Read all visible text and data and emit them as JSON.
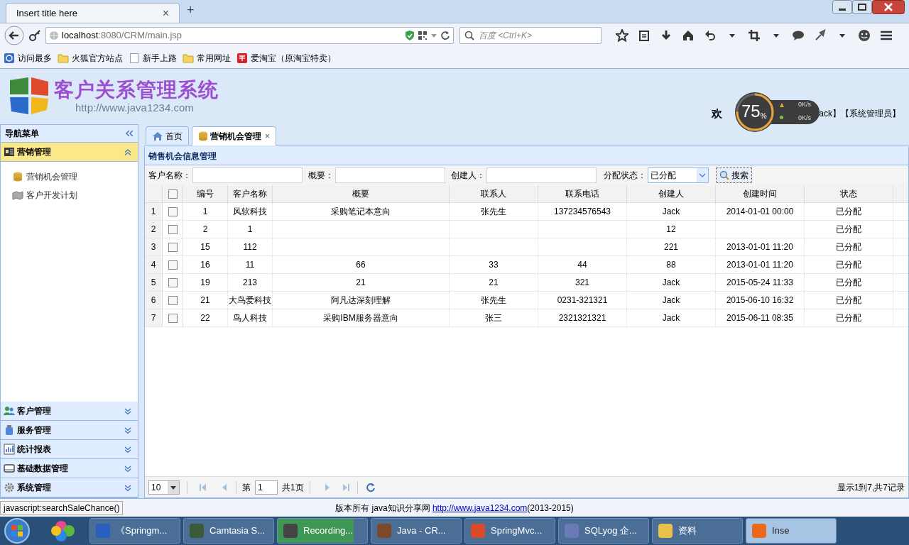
{
  "browser": {
    "tab_title": "Insert title here",
    "tab_close": "×",
    "new_tab": "+",
    "url_host": "localhost",
    "url_rest": ":8080/CRM/main.jsp",
    "search_placeholder": "百度 <Ctrl+K>"
  },
  "bookmarks": [
    {
      "label": "访问最多",
      "kind": "history"
    },
    {
      "label": "火狐官方站点",
      "kind": "folder"
    },
    {
      "label": "新手上路",
      "kind": "page"
    },
    {
      "label": "常用网址",
      "kind": "folder"
    },
    {
      "label": "爱淘宝（原淘宝特卖）",
      "kind": "taobao"
    }
  ],
  "header": {
    "title": "客户关系管理系统",
    "url": "http://www.java1234.com",
    "welcome": "欢",
    "user": "ack】【系统管理员】"
  },
  "speed_widget": {
    "percent": "75",
    "unit": "%",
    "upload": "0K/s",
    "download": "0K/s"
  },
  "sidebar": {
    "title": "导航菜单",
    "groups": [
      {
        "label": "营销管理",
        "expanded": true,
        "children": [
          {
            "label": "营销机会管理"
          },
          {
            "label": "客户开发计划"
          }
        ]
      },
      {
        "label": "客户管理",
        "expanded": false
      },
      {
        "label": "服务管理",
        "expanded": false
      },
      {
        "label": "统计报表",
        "expanded": false
      },
      {
        "label": "基础数据管理",
        "expanded": false
      },
      {
        "label": "系统管理",
        "expanded": false
      }
    ]
  },
  "tabs": [
    {
      "label": "首页",
      "selected": false
    },
    {
      "label": "营销机会管理",
      "selected": true,
      "close": "×"
    }
  ],
  "panel_title": "销售机会信息管理",
  "search": {
    "fields": [
      {
        "label": "客户名称："
      },
      {
        "label": "概要："
      },
      {
        "label": "创建人："
      }
    ],
    "select": {
      "label": "分配状态：",
      "value": "已分配"
    },
    "button": "搜索"
  },
  "table": {
    "header_checked": false,
    "columns": [
      "编号",
      "客户名称",
      "概要",
      "联系人",
      "联系电话",
      "创建人",
      "创建时间",
      "状态"
    ],
    "rows": [
      {
        "num": "1",
        "checked": false,
        "cells": [
          "1",
          "风软科技",
          "采购笔记本意向",
          "张先生",
          "137234576543",
          "Jack",
          "2014-01-01 00:00",
          "已分配"
        ]
      },
      {
        "num": "2",
        "checked": false,
        "cells": [
          "2",
          "1",
          null,
          null,
          null,
          "12",
          null,
          "已分配"
        ]
      },
      {
        "num": "3",
        "checked": false,
        "cells": [
          "15",
          "112",
          null,
          null,
          null,
          "221",
          "2013-01-01 11:20",
          "已分配"
        ]
      },
      {
        "num": "4",
        "checked": false,
        "cells": [
          "16",
          "11",
          "66",
          "33",
          "44",
          "88",
          "2013-01-01 11:20",
          "已分配"
        ]
      },
      {
        "num": "5",
        "checked": false,
        "cells": [
          "19",
          "213",
          "21",
          "21",
          "321",
          "Jack",
          "2015-05-24 11:33",
          "已分配"
        ]
      },
      {
        "num": "6",
        "checked": false,
        "cells": [
          "21",
          "大鸟爱科技",
          "阿凡达深刻理解",
          "张先生",
          "0231-321321",
          "Jack",
          "2015-06-10 16:32",
          "已分配"
        ]
      },
      {
        "num": "7",
        "checked": false,
        "cells": [
          "22",
          "鸟人科技",
          "采购IBM服务器意向",
          "张三",
          "2321321321",
          "Jack",
          "2015-06-11 08:35",
          "已分配"
        ]
      }
    ]
  },
  "pager": {
    "page_size": "10",
    "page_label": "第",
    "page": "1",
    "total_pages": "共1页",
    "summary": "显示1到7,共7记录"
  },
  "status_bar": "javascript:searchSaleChance()",
  "footer": {
    "text": "版本所有 java知识分享网 ",
    "link": "http://www.java1234.com",
    "suffix": "(2013-2015)"
  },
  "taskbar": [
    {
      "label": "《Springm...",
      "selected": false
    },
    {
      "label": "Camtasia S...",
      "selected": false
    },
    {
      "label": "Recording...",
      "selected": false,
      "level": 0.85
    },
    {
      "label": "Java - CR...",
      "selected": false
    },
    {
      "label": "SpringMvc...",
      "selected": false
    },
    {
      "label": "SQLyog 企...",
      "selected": false
    },
    {
      "label": "资料",
      "selected": false
    },
    {
      "label": "Inse",
      "selected": true
    }
  ]
}
